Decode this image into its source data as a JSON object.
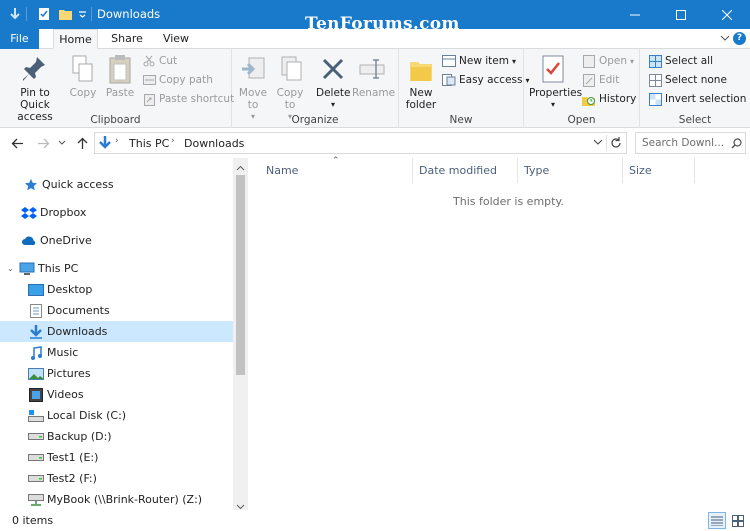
{
  "window": {
    "title": "Downloads",
    "watermark": "TenForums.com"
  },
  "tabs": {
    "file": "File",
    "home": "Home",
    "share": "Share",
    "view": "View"
  },
  "ribbon": {
    "clipboard": {
      "label": "Clipboard",
      "pin": "Pin to Quick access",
      "copy": "Copy",
      "paste": "Paste",
      "cut": "Cut",
      "copy_path": "Copy path",
      "paste_shortcut": "Paste shortcut"
    },
    "organize": {
      "label": "Organize",
      "move_to": "Move to",
      "copy_to": "Copy to",
      "delete": "Delete",
      "rename": "Rename"
    },
    "new": {
      "label": "New",
      "new_folder": "New folder",
      "new_item": "New item",
      "easy_access": "Easy access"
    },
    "open": {
      "label": "Open",
      "properties": "Properties",
      "open": "Open",
      "edit": "Edit",
      "history": "History"
    },
    "select": {
      "label": "Select",
      "select_all": "Select all",
      "select_none": "Select none",
      "invert": "Invert selection"
    }
  },
  "address": {
    "crumbs": [
      "This PC",
      "Downloads"
    ],
    "search_placeholder": "Search Downl..."
  },
  "nav": {
    "quick_access": "Quick access",
    "dropbox": "Dropbox",
    "onedrive": "OneDrive",
    "this_pc": "This PC",
    "items": [
      "Desktop",
      "Documents",
      "Downloads",
      "Music",
      "Pictures",
      "Videos",
      "Local Disk (C:)",
      "Backup (D:)",
      "Test1 (E:)",
      "Test2 (F:)",
      "MyBook (\\\\Brink-Router) (Z:)"
    ]
  },
  "columns": {
    "name": "Name",
    "date": "Date modified",
    "type": "Type",
    "size": "Size"
  },
  "content": {
    "empty": "This folder is empty."
  },
  "status": {
    "items": "0 items"
  }
}
